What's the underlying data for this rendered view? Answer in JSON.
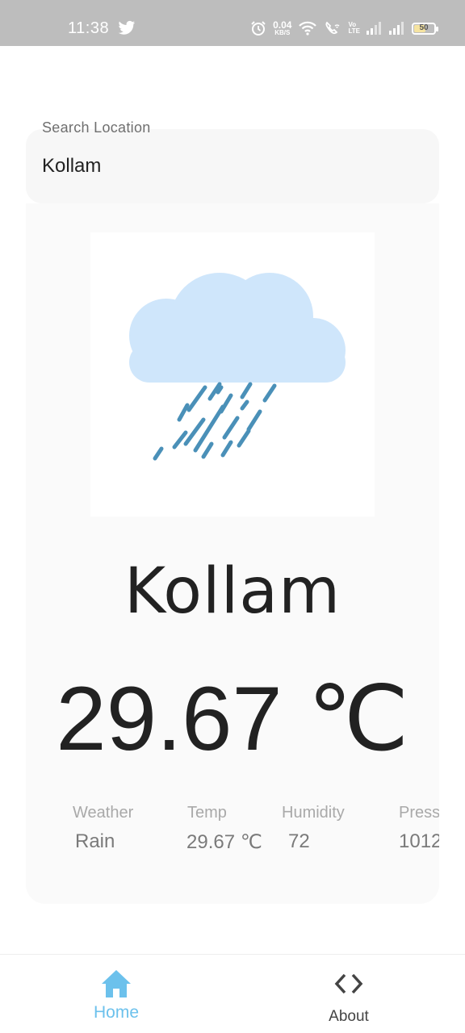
{
  "status_bar": {
    "time": "11:38",
    "net_speed_value": "0.04",
    "net_speed_unit": "KB/S",
    "volte_top": "Vo",
    "volte_bottom": "LTE",
    "battery_level": "50"
  },
  "search": {
    "label": "Search Location",
    "value": "Kollam"
  },
  "weather": {
    "icon": "rain-cloud-icon",
    "city": "Kollam",
    "temperature": "29.67 ℃",
    "stats": [
      {
        "label": "Weather",
        "value": "Rain"
      },
      {
        "label": "Temp",
        "value": "29.67 ℃"
      },
      {
        "label": "Humidity",
        "value": "72"
      },
      {
        "label": "Pressure",
        "value": "1012"
      }
    ]
  },
  "nav": {
    "items": [
      {
        "label": "Home",
        "icon": "home-icon",
        "active": true
      },
      {
        "label": "About",
        "icon": "code-icon",
        "active": false
      }
    ]
  },
  "colors": {
    "status_bar": "#bdbdbd",
    "accent": "#6cc1ec",
    "cloud": "#cfe6fb",
    "rain": "#4a90b8",
    "card": "#fafafa",
    "field": "#f7f7f7"
  }
}
